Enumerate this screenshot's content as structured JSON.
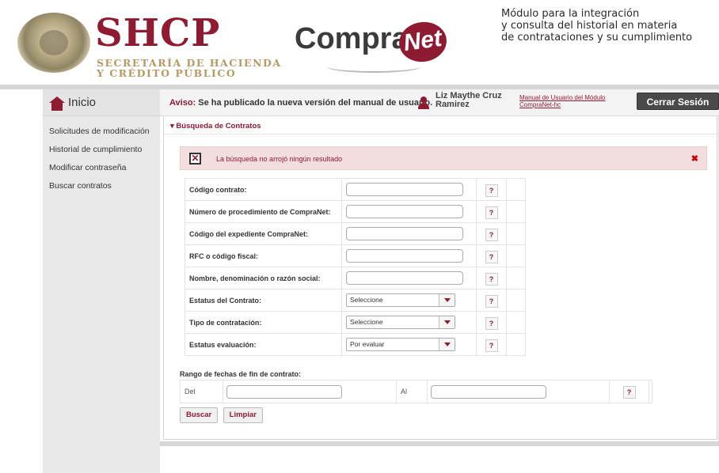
{
  "header": {
    "shcp_title": "SHCP",
    "shcp_sub_1": "SECRETARÍA DE HACIENDA",
    "shcp_sub_2": "Y CRÉDITO PÚBLICO",
    "compranet_left": "Compra",
    "compranet_right": "Net",
    "module_line_1": "Módulo para la integración",
    "module_line_2": "y consulta del historial en materia",
    "module_line_3": "de contrataciones y su cumplimiento"
  },
  "topbar": {
    "inicio": "Inicio",
    "aviso_label": "Aviso:",
    "aviso_text": " Se ha publicado la nueva versión del manual de usuario.",
    "user_name_1": "Liz Maythe Cruz",
    "user_name_2": "Ramirez",
    "manual_1": "Manual de Usuario del Módulo",
    "manual_2": "CompraNet-hc",
    "logout": "Cerrar Sesión"
  },
  "sidebar": {
    "items": [
      {
        "label": "Solicitudes de modificación"
      },
      {
        "label": "Historial de cumplimiento"
      },
      {
        "label": "Modificar contraseña"
      },
      {
        "label": "Buscar contratos"
      }
    ]
  },
  "main": {
    "section_title": "▾ Búsqueda de Contratos",
    "alert_message": "La búsqueda no arrojó ningún resultado",
    "alert_close": "✖",
    "help_symbol": "?",
    "fields": {
      "codigo_contrato": "Código contrato:",
      "num_procedimiento": "Número de procedimiento de CompraNet:",
      "codigo_expediente": "Código del expediente CompraNet:",
      "rfc": "RFC o código fiscal:",
      "nombre": "Nombre, denominación o razón social:",
      "estatus_contrato": "Estatus del Contrato:",
      "tipo_contratacion": "Tipo de contratación:",
      "estatus_evaluacion": "Estatus evaluación:"
    },
    "selects": {
      "estatus_contrato": "Seleccione",
      "tipo_contratacion": "Seleccione",
      "estatus_evaluacion": "Por evaluar"
    },
    "range_label": "Rango de fechas de fin de contrato:",
    "del_label": "Del",
    "al_label": "Al",
    "buscar": "Buscar",
    "limpiar": "Limpiar"
  },
  "colors": {
    "brand": "#8e1b32",
    "gold": "#b59a63",
    "alert_bg": "#f2dede"
  }
}
